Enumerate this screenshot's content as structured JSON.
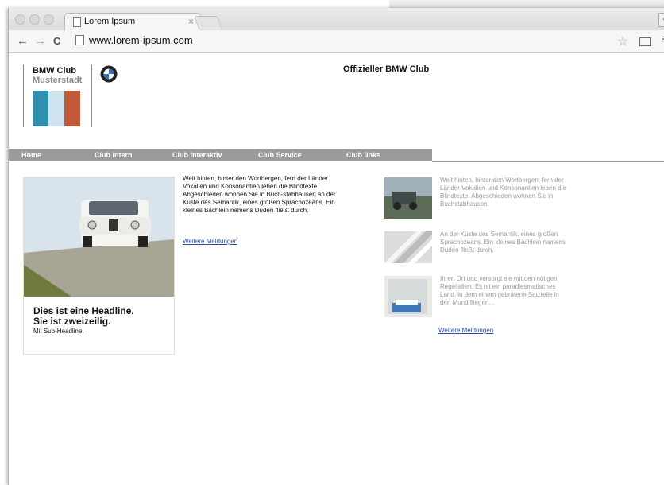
{
  "browser": {
    "tab_title": "Lorem Ipsum",
    "tab_close": "×",
    "url": "www.lorem-ipsum.com",
    "nav": {
      "back": "←",
      "forward": "→",
      "reload": "C"
    },
    "star": "☆",
    "menu": "≡"
  },
  "header": {
    "logo_line1": "BMW Club",
    "logo_line2": "Musterstadt",
    "flag_colors": [
      "#2e8fae",
      "#cfe4ee",
      "#c25a3a"
    ],
    "official": "Offizieller BMW Club"
  },
  "nav": {
    "items": [
      {
        "label": "Home"
      },
      {
        "label": "Club intern"
      },
      {
        "label": "Club interaktiv"
      },
      {
        "label": "Club Service"
      },
      {
        "label": "Club links"
      }
    ]
  },
  "feature": {
    "headline_line1": "Dies ist eine Headline.",
    "headline_line2": "Sie ist zweizeilig.",
    "subheadline": "Mit Sub-Headline."
  },
  "main": {
    "text": "Weit hinten, hinter den Wortbergen, fern der Länder Vokalien und Konsonantien leben die Blindtexte. Abgeschieden wohnen Sie in Buch-stabhausen.an der Küste des Semantik, eines großen Sprachozeans. Ein kleines Bächlein namens Duden fließt durch.",
    "link": "Weitere Meldungen"
  },
  "sidebar": {
    "items": [
      {
        "text": "Weit hinten, hinter den Wortbergen, fern der Länder Vokalien und Konsonantien leben die Blindtexte. Abgeschieden wohnen Sie in Buchstabhausen."
      },
      {
        "text": "An der Küste des Semantik, eines großen Sprachozeans. Ein kleines Bächlein namens Duden fließt durch."
      },
      {
        "text": "Ihren Ort und versorgt sie mit den nötigen Regelialien. Es ist ein paradiesmatisches Land, in dem einem gebratene Satzteile in den Mund fliegen. ."
      }
    ],
    "link": "Weitere Meldungen"
  },
  "colors": {
    "nav_bg": "#9a9a9a",
    "link": "#2a4fa8",
    "muted_text": "#9a9a9a"
  }
}
